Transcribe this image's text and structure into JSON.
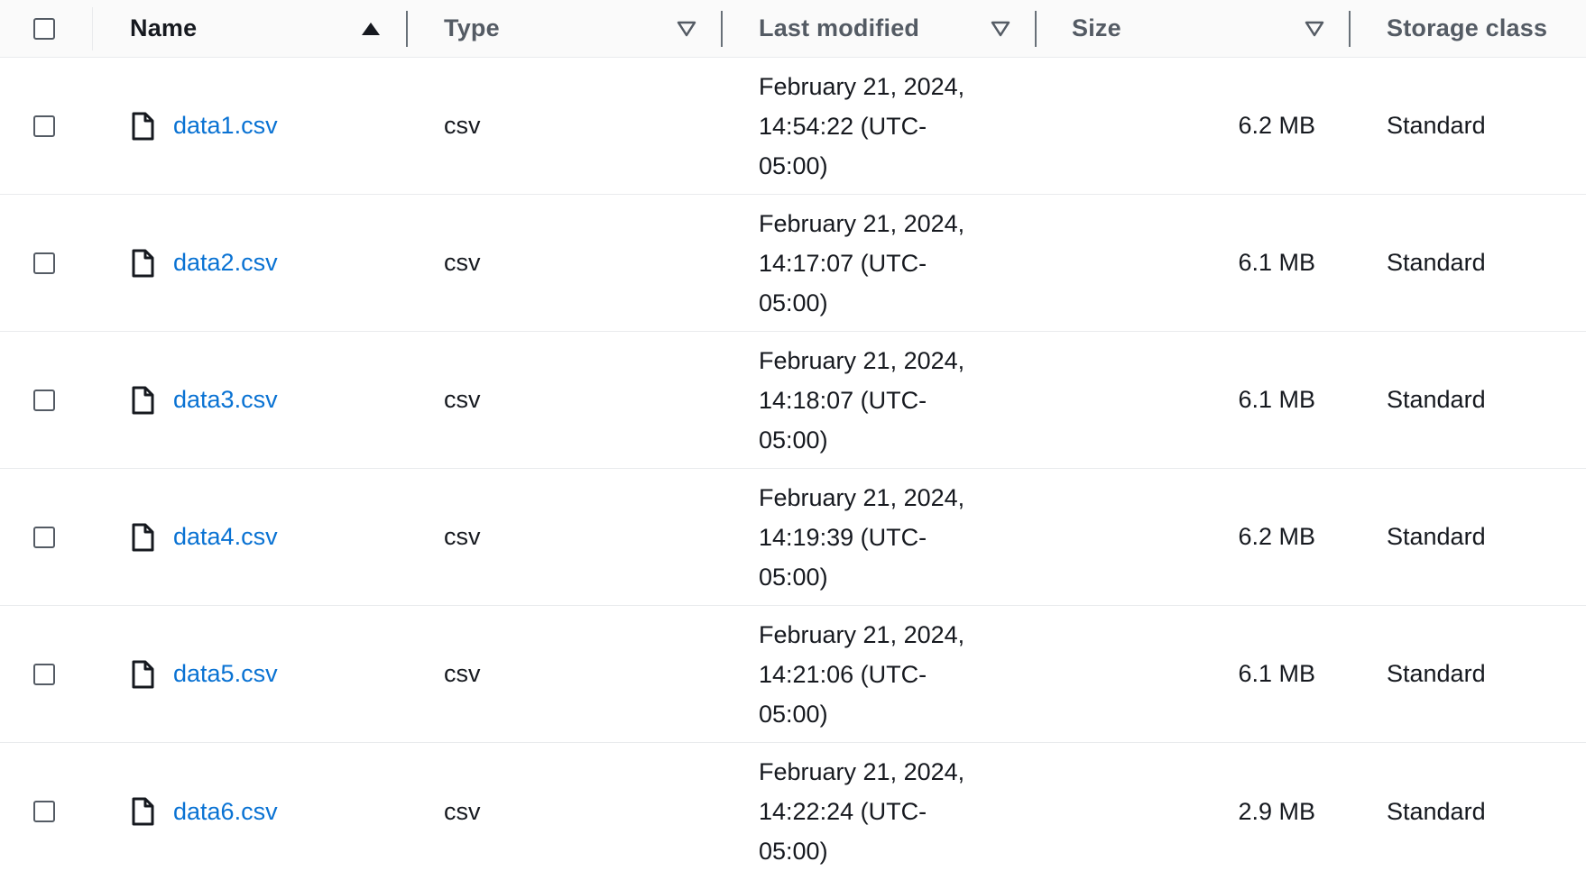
{
  "columns": {
    "name": "Name",
    "type": "Type",
    "last_modified": "Last modified",
    "size": "Size",
    "storage_class": "Storage class"
  },
  "colors": {
    "link": "#0972d3",
    "text": "#16191f",
    "header_bg": "#fafafa",
    "border": "#e9ebed"
  },
  "rows": [
    {
      "name": "data1.csv",
      "type": "csv",
      "last_modified_date": "February 21, 2024,",
      "last_modified_time": "14:54:22 (UTC-",
      "last_modified_tz": "05:00)",
      "size": "6.2 MB",
      "storage_class": "Standard"
    },
    {
      "name": "data2.csv",
      "type": "csv",
      "last_modified_date": "February 21, 2024,",
      "last_modified_time": "14:17:07 (UTC-",
      "last_modified_tz": "05:00)",
      "size": "6.1 MB",
      "storage_class": "Standard"
    },
    {
      "name": "data3.csv",
      "type": "csv",
      "last_modified_date": "February 21, 2024,",
      "last_modified_time": "14:18:07 (UTC-",
      "last_modified_tz": "05:00)",
      "size": "6.1 MB",
      "storage_class": "Standard"
    },
    {
      "name": "data4.csv",
      "type": "csv",
      "last_modified_date": "February 21, 2024,",
      "last_modified_time": "14:19:39 (UTC-",
      "last_modified_tz": "05:00)",
      "size": "6.2 MB",
      "storage_class": "Standard"
    },
    {
      "name": "data5.csv",
      "type": "csv",
      "last_modified_date": "February 21, 2024,",
      "last_modified_time": "14:21:06 (UTC-",
      "last_modified_tz": "05:00)",
      "size": "6.1 MB",
      "storage_class": "Standard"
    },
    {
      "name": "data6.csv",
      "type": "csv",
      "last_modified_date": "February 21, 2024,",
      "last_modified_time": "14:22:24 (UTC-",
      "last_modified_tz": "05:00)",
      "size": "2.9 MB",
      "storage_class": "Standard"
    }
  ]
}
